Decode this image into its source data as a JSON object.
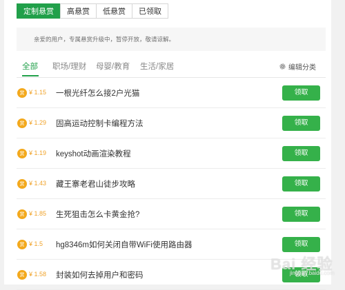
{
  "top_tabs": [
    {
      "label": "定制悬赏",
      "active": true
    },
    {
      "label": "高悬赏",
      "active": false
    },
    {
      "label": "低悬赏",
      "active": false
    },
    {
      "label": "已领取",
      "active": false
    }
  ],
  "notice": "亲爱的用户，专属悬赏升级中，暂停开放，敬请谅解。",
  "categories": [
    {
      "label": "全部",
      "active": true
    },
    {
      "label": "职场/理财",
      "active": false
    },
    {
      "label": "母婴/教育",
      "active": false
    },
    {
      "label": "生活/家居",
      "active": false
    }
  ],
  "edit_categories": "编辑分类",
  "coin_glyph": "赏",
  "rows": [
    {
      "amount": "¥ 1.15",
      "title": "一根光纤怎么接2户光猫",
      "button": "领取"
    },
    {
      "amount": "¥ 1.29",
      "title": "固高运动控制卡编程方法",
      "button": "领取"
    },
    {
      "amount": "¥ 1.19",
      "title": "keyshot动画渲染教程",
      "button": "领取"
    },
    {
      "amount": "¥ 1.43",
      "title": "藏王寨老君山徒步攻略",
      "button": "领取"
    },
    {
      "amount": "¥ 1.85",
      "title": "生死狙击怎么卡黄金抢?",
      "button": "领取"
    },
    {
      "amount": "¥ 1.5",
      "title": "hg8346m如何关闭自带WiFi使用路由器",
      "button": "领取"
    },
    {
      "amount": "¥ 1.58",
      "title": "封装如何去掉用户和密码",
      "button": "领取"
    }
  ],
  "watermark": {
    "main": "Bai 经验",
    "sub": "jingyan.baidu.com"
  },
  "colors": {
    "accent": "#21a04a",
    "button": "#35b14a",
    "coin": "#f3a91d",
    "amount": "#f0a32a"
  }
}
